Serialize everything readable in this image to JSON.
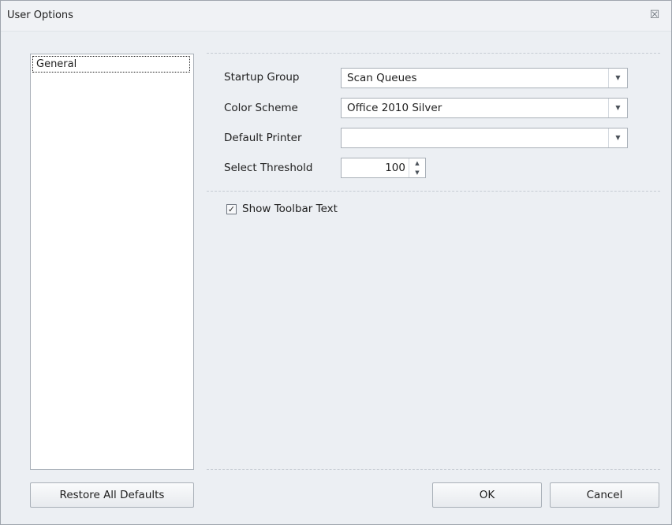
{
  "window": {
    "title": "User Options",
    "close_symbol": "☒"
  },
  "sidebar": {
    "items": [
      {
        "label": "General"
      }
    ]
  },
  "form": {
    "startup_group": {
      "label": "Startup Group",
      "value": "Scan Queues"
    },
    "color_scheme": {
      "label": "Color Scheme",
      "value": "Office 2010 Silver"
    },
    "default_printer": {
      "label": "Default Printer",
      "value": ""
    },
    "select_threshold": {
      "label": "Select Threshold",
      "value": "100"
    },
    "show_toolbar_text": {
      "label": "Show Toolbar Text",
      "checked": true,
      "check_mark": "✓"
    }
  },
  "glyphs": {
    "dropdown": "▼",
    "spin_up": "▲",
    "spin_down": "▼"
  },
  "buttons": {
    "restore": "Restore All Defaults",
    "ok": "OK",
    "cancel": "Cancel"
  },
  "colors": {
    "background": "#eceff3",
    "border": "#a9b0b8",
    "title_bar": "#f0f2f5"
  }
}
